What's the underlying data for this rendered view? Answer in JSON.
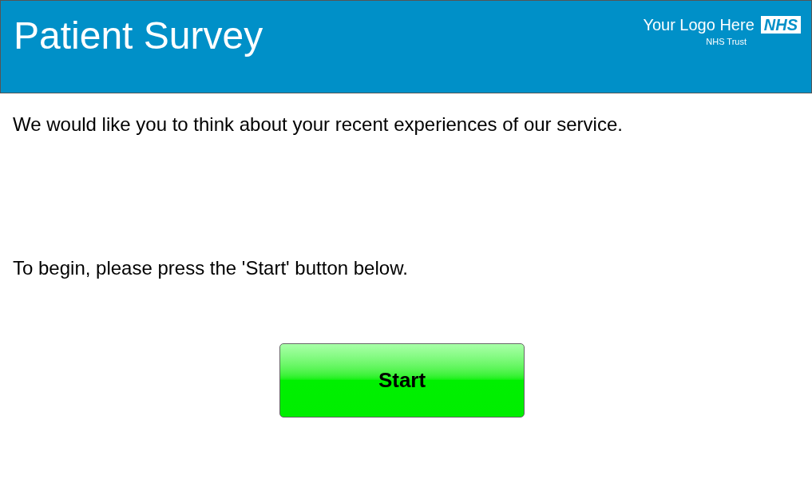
{
  "header": {
    "title": "Patient Survey",
    "logo": {
      "text": "Your Logo Here",
      "badge": "NHS",
      "subtitle": "NHS Trust"
    }
  },
  "paragraphs": [
    "We would like you to think about your recent experiences of our service.",
    "To begin, please press the 'Start' button below."
  ],
  "start_button": {
    "label": "Start"
  }
}
